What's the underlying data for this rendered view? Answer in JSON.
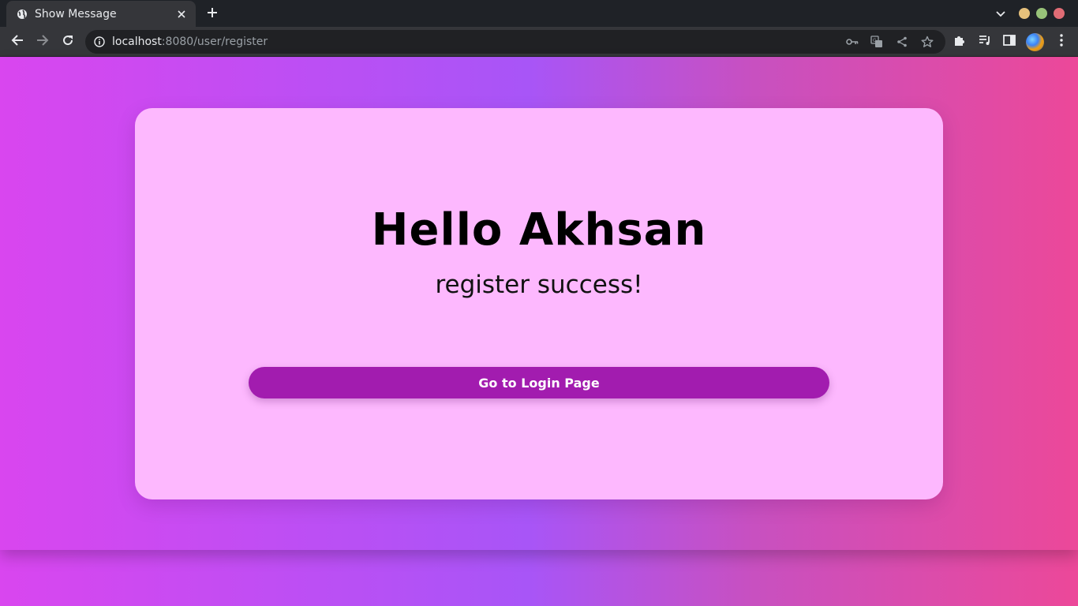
{
  "browser": {
    "tab_title": "Show Message",
    "url_host": "localhost",
    "url_rest": ":8080/user/register",
    "icons": {
      "tab": "globe-icon",
      "close": "close-icon",
      "new_tab": "plus-icon",
      "tab_search": "chevron-down-icon",
      "back": "arrow-left-icon",
      "forward": "arrow-right-icon",
      "reload": "reload-icon",
      "site_info": "info-icon",
      "password": "key-icon",
      "translate": "translate-icon",
      "share": "share-icon",
      "bookmark": "star-icon",
      "extensions": "puzzle-icon",
      "reading_list": "reading-list-icon",
      "side_panel": "side-panel-icon",
      "menu": "more-vertical-icon"
    },
    "window_controls": {
      "minimize_color": "#e5c07b",
      "maximize_color": "#98c379",
      "close_color": "#e06c75"
    }
  },
  "page": {
    "heading": "Hello Akhsan",
    "message": "register success!",
    "button_label": "Go to Login Page",
    "colors": {
      "card": "#fdb8fe",
      "button": "#a21caf",
      "gradient_start": "#d946ef",
      "gradient_mid": "#a855f7",
      "gradient_end": "#ec4899"
    }
  }
}
